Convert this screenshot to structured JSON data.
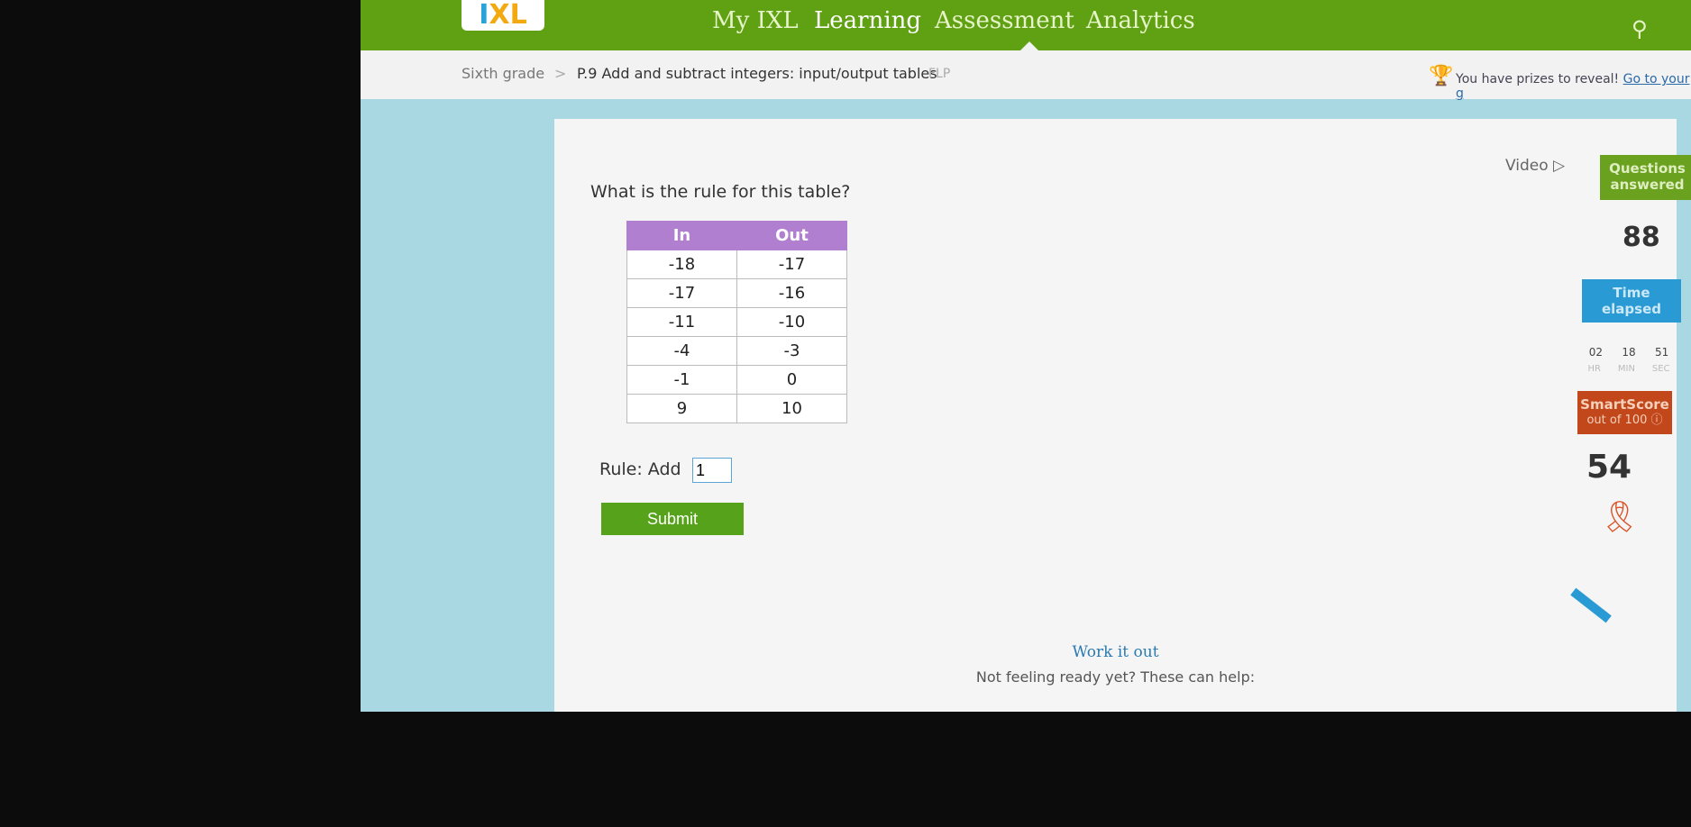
{
  "header": {
    "logo": "IXL",
    "nav": [
      "My IXL",
      "Learning",
      "Assessment",
      "Analytics"
    ],
    "active": "Learning"
  },
  "breadcrumb": {
    "grade": "Sixth grade",
    "separator": ">",
    "skill": "P.9 Add and subtract integers: input/output tables",
    "code": "FLP"
  },
  "prize": {
    "text": "You have prizes to reveal!",
    "link": "Go to your g"
  },
  "question": {
    "prompt": "What is the rule for this table?",
    "table": {
      "headers": [
        "In",
        "Out"
      ],
      "rows": [
        [
          "-18",
          "-17"
        ],
        [
          "-17",
          "-16"
        ],
        [
          "-11",
          "-10"
        ],
        [
          "-4",
          "-3"
        ],
        [
          "-1",
          "0"
        ],
        [
          "9",
          "10"
        ]
      ]
    },
    "rule_label": "Rule: Add",
    "answer_value": "1",
    "submit_label": "Submit"
  },
  "sidebar": {
    "video_label": "Video",
    "questions_label": "Questions answered",
    "questions_value": "88",
    "time_label": "Time elapsed",
    "time": {
      "hr": "02",
      "min": "18",
      "sec": "51"
    },
    "time_units": {
      "hr": "HR",
      "min": "MIN",
      "sec": "SEC"
    },
    "smartscore_label": "SmartScore",
    "smartscore_sub": "out of 100",
    "smartscore_value": "54"
  },
  "footer": {
    "work_it_out": "Work it out",
    "help_text": "Not feeling ready yet? These can help:"
  },
  "colors": {
    "header_green": "#5fa112",
    "table_header": "#b07fcf",
    "submit": "#57a21b",
    "time_blue": "#2a9ad4",
    "smartscore": "#c2471a"
  }
}
